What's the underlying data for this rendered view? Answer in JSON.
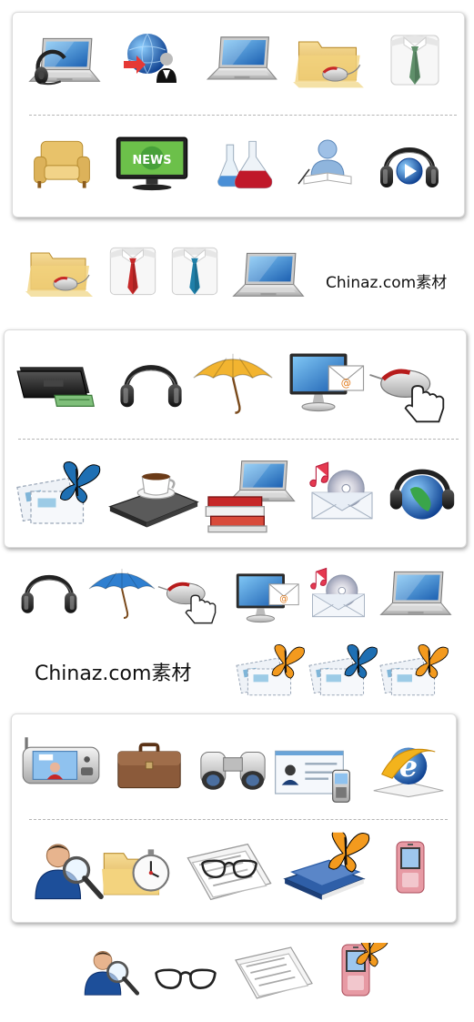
{
  "watermarks": {
    "first": "Chinaz.com素材",
    "second": "Chinaz.com素材"
  },
  "colors": {
    "screen_blue": "#2a7fd0",
    "folder_yellow": "#e9c46a",
    "tie_red": "#c62828",
    "tie_green": "#5f8f6a",
    "tie_blue": "#1f7fa8",
    "butterfly_blue": "#1e6fb3",
    "butterfly_orange": "#f39a1e"
  },
  "panels": [
    {
      "id": "panel-1",
      "rows": [
        [
          "laptop-headset-icon",
          "globe-user-icon",
          "laptop-icon",
          "folder-mouse-icon",
          "shirt-green-tie-icon"
        ],
        [
          "armchair-icon",
          "news-tv-icon",
          "lab-flasks-icon",
          "user-reading-icon",
          "headphones-play-icon"
        ]
      ]
    },
    {
      "id": "panel-2",
      "rows": [
        [
          "wallet-icon",
          "headphones-icon",
          "umbrella-yellow-icon",
          "monitor-mail-icon",
          "mouse-hand-icon"
        ],
        [
          "mail-butterfly-icon",
          "coffee-laptop-icon",
          "books-laptop-icon",
          "cd-mail-music-icon",
          "globe-headphones-icon"
        ]
      ]
    },
    {
      "id": "panel-3",
      "rows": [
        [
          "video-phone-icon",
          "briefcase-icon",
          "binoculars-icon",
          "business-card-phone-icon",
          "internet-explorer-icon"
        ],
        [
          "user-search-icon",
          "folder-stopwatch-icon",
          "newspaper-glasses-icon",
          "books-butterfly-icon",
          "flip-phone-icon"
        ]
      ]
    }
  ],
  "loose_rows": [
    [
      "folder-mouse-icon",
      "shirt-red-tie-icon",
      "shirt-blue-tie-icon",
      "laptop-icon"
    ],
    [
      "headphones-icon",
      "umbrella-blue-icon",
      "mouse-hand-icon",
      "monitor-mail-icon",
      "cd-mail-music-icon",
      "laptop-icon"
    ],
    [
      "mail-butterfly-icon",
      "mail-butterfly-icon",
      "mail-butterfly-icon"
    ],
    [
      "user-search-icon",
      "glasses-icon",
      "newspaper-icon",
      "flip-phone-butterfly-icon"
    ]
  ]
}
